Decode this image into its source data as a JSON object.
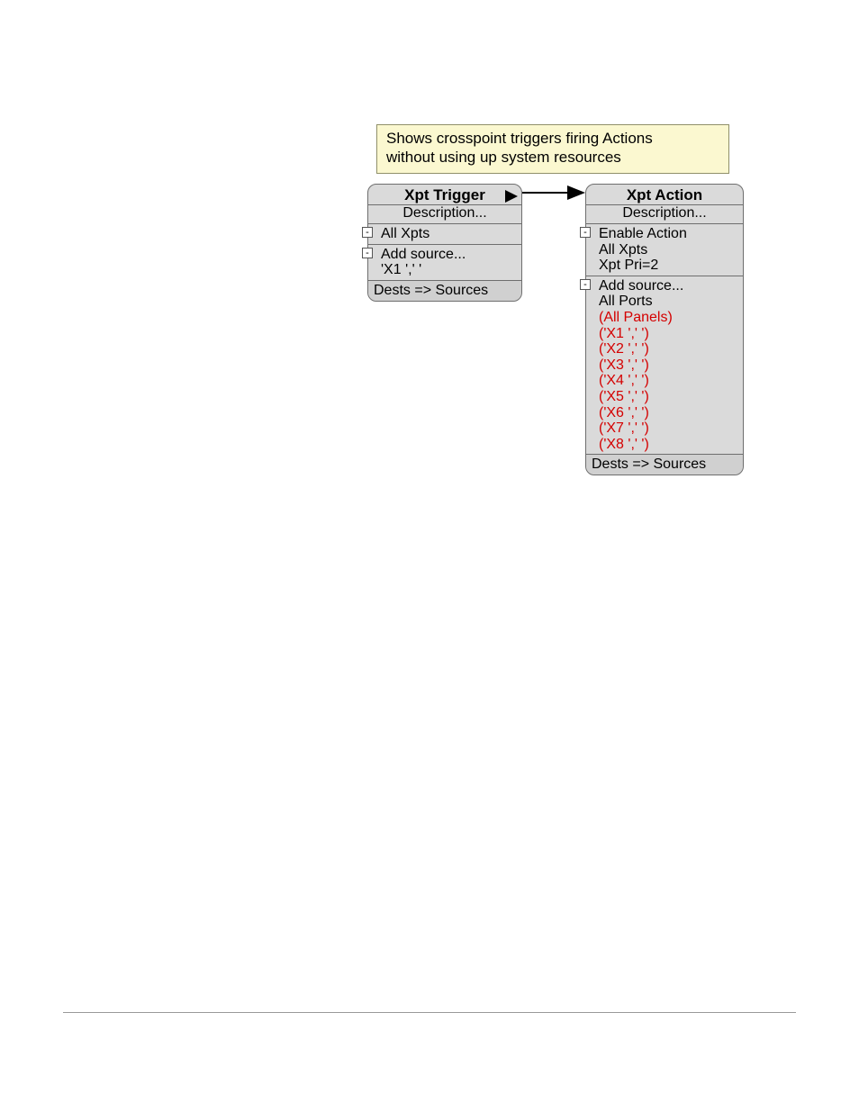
{
  "tooltip": {
    "line1": "Shows crosspoint triggers firing Actions",
    "line2": "without using up system resources"
  },
  "trigger_node": {
    "title": "Xpt Trigger",
    "description": "Description...",
    "section1": {
      "line1": "All Xpts"
    },
    "section2": {
      "line1": "Add source...",
      "line2": "'X1   ','     '"
    },
    "footer": "Dests => Sources"
  },
  "action_node": {
    "title": "Xpt Action",
    "description": "Description...",
    "section1": {
      "line1": "Enable Action",
      "line2": "All Xpts",
      "line3": "Xpt Pri=2"
    },
    "section2": {
      "line1": "Add source...",
      "line2": "All Ports",
      "red_lines": [
        "(All Panels)",
        "('X1   ','     ')",
        "('X2   ','     ')",
        "('X3   ','     ')",
        "('X4   ','     ')",
        "('X5   ','     ')",
        "('X6   ','     ')",
        "('X7   ','     ')",
        "('X8   ','     ')"
      ]
    },
    "footer": "Dests => Sources"
  },
  "collapse_glyph": "-"
}
